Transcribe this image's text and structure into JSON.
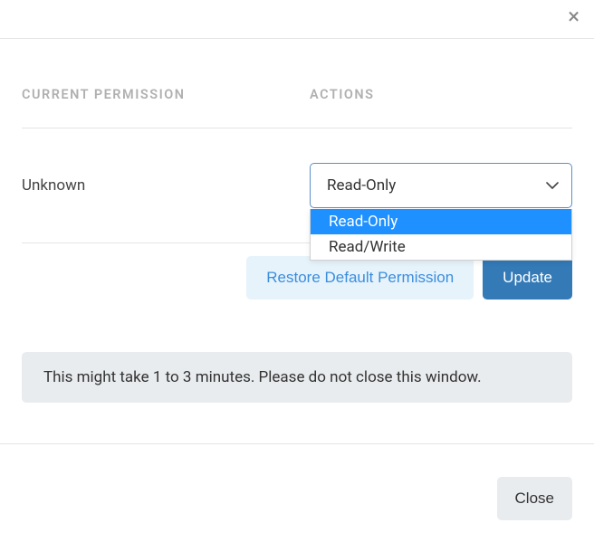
{
  "header": {
    "close_x": "×"
  },
  "columns": {
    "current_permission_header": "CURRENT PERMISSION",
    "actions_header": "ACTIONS"
  },
  "row": {
    "current_permission_value": "Unknown",
    "select": {
      "value": "Read-Only",
      "options": [
        {
          "label": "Read-Only",
          "highlighted": true
        },
        {
          "label": "Read/Write",
          "highlighted": false
        }
      ]
    }
  },
  "buttons": {
    "restore_label": "Restore Default Permission",
    "update_label": "Update"
  },
  "notice": {
    "text": "This might take 1 to 3 minutes. Please do not close this window."
  },
  "footer": {
    "close_label": "Close"
  }
}
